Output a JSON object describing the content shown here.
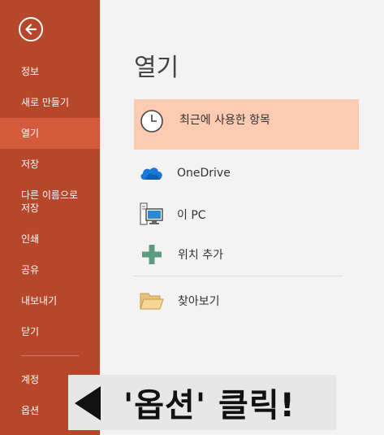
{
  "sidebar": {
    "items": [
      {
        "label": "정보"
      },
      {
        "label": "새로 만들기"
      },
      {
        "label": "열기"
      },
      {
        "label": "저장"
      },
      {
        "label": "다른 이름으로\n저장"
      },
      {
        "label": "인쇄"
      },
      {
        "label": "공유"
      },
      {
        "label": "내보내기"
      },
      {
        "label": "닫기"
      },
      {
        "label": "계정"
      },
      {
        "label": "옵션"
      }
    ],
    "active": "열기"
  },
  "main": {
    "title": "열기",
    "locations": [
      {
        "label": "최근에 사용한 항목",
        "icon": "clock-icon"
      },
      {
        "label": "OneDrive",
        "icon": "onedrive-cloud-icon"
      },
      {
        "label": "이 PC",
        "icon": "this-pc-icon"
      },
      {
        "label": "위치 추가",
        "icon": "plus-icon"
      },
      {
        "label": "찾아보기",
        "icon": "folder-icon"
      }
    ]
  },
  "callout": {
    "text": "'옵션' 클릭!"
  },
  "colors": {
    "sidebar": "#b7472a",
    "sidebar_active": "#d35a3b",
    "selected_row": "#fccbb2",
    "background": "#f3f3f3"
  }
}
